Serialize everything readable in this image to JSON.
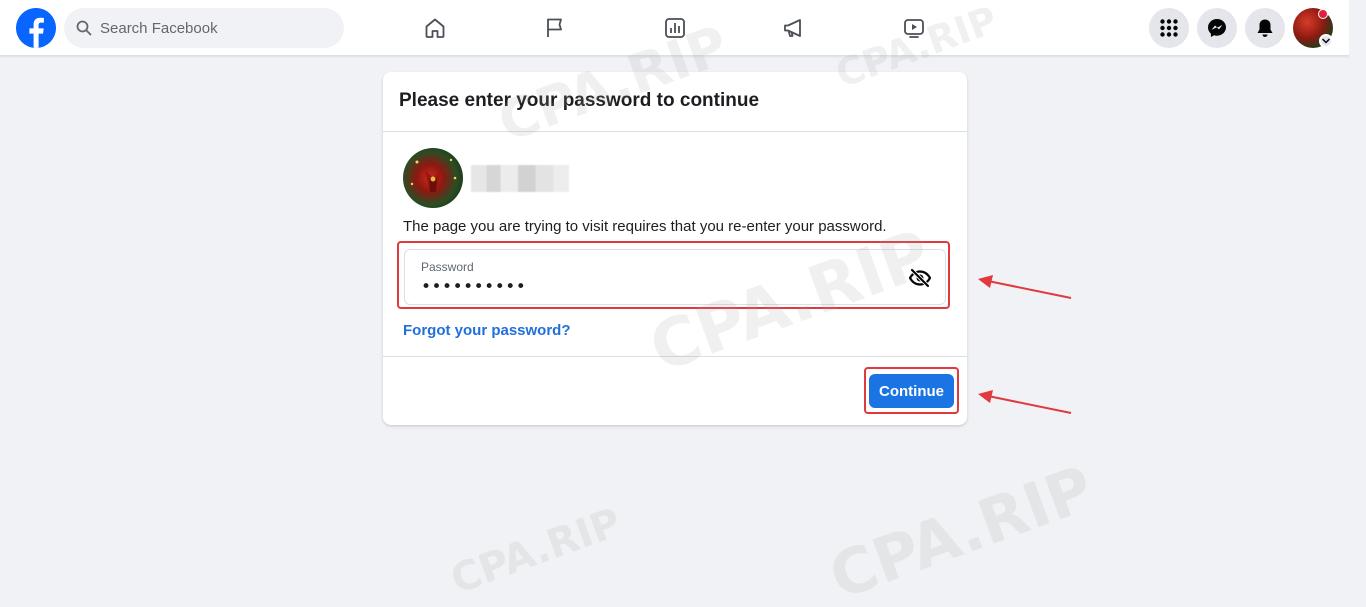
{
  "header": {
    "search_placeholder": "Search Facebook",
    "nav_icons": [
      "home-icon",
      "flag-icon",
      "chart-icon",
      "megaphone-icon",
      "video-icon"
    ],
    "right_buttons": [
      "menu-grid-icon",
      "messenger-icon",
      "bell-icon"
    ]
  },
  "dialog": {
    "title": "Please enter your password to continue",
    "description": "The page you are trying to visit requires that you re-enter your password.",
    "password_label": "Password",
    "password_value": "••••••••••",
    "forgot_link": "Forgot your password?",
    "continue_label": "Continue"
  },
  "watermark": "CPA.RIP",
  "colors": {
    "brand_blue": "#0866ff",
    "button_blue": "#1b74e4",
    "link_blue": "#216fdb",
    "annotation_red": "#e0393e"
  }
}
